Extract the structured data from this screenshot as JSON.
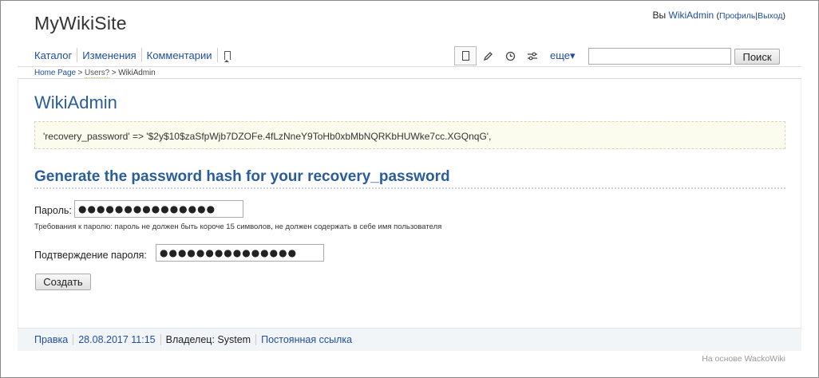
{
  "site": {
    "title": "MyWikiSite"
  },
  "user": {
    "prefix": "Вы",
    "name": "WikiAdmin",
    "open_paren": "(",
    "profile": "Профиль",
    "pipe": "|",
    "logout": "Выход",
    "close_paren": ")"
  },
  "nav": {
    "items": [
      "Каталог",
      "Изменения",
      "Комментарии"
    ]
  },
  "toolbar": {
    "more_label": "еще▾",
    "icons": [
      "page-icon",
      "pencil-icon",
      "clock-icon",
      "sliders-icon"
    ]
  },
  "search": {
    "value": "",
    "placeholder": "",
    "button_label": "Поиск"
  },
  "breadcrumb": {
    "home": "Home Page",
    "sep1": " > ",
    "users": "Users?",
    "sep2": " > ",
    "current": "WikiAdmin"
  },
  "page": {
    "title": "WikiAdmin",
    "code": "'recovery_password' => '$2y$10$zaSfpWjb7DZOFe.4fLzNneY9ToHb0xbMbNQRKbHUWke7cc.XGQnqG',"
  },
  "form": {
    "section_title": "Generate the password hash for your recovery_password",
    "password_label": "Пароль:",
    "password_value": "●●●●●●●●●●●●●●●",
    "hint": "Требования к паролю: пароль не должен быть короче 15 символов, не должен содержать в себе имя пользователя",
    "confirm_label": "Подтверждение пароля:",
    "confirm_value": "●●●●●●●●●●●●●●●",
    "submit_label": "Создать"
  },
  "footer": {
    "edit": "Правка",
    "date": "28.08.2017 11:15",
    "owner": "Владелец: System",
    "permalink": "Постоянная ссылка",
    "powered": "На основе WackoWiki"
  },
  "colors": {
    "link": "#1f4e9c",
    "title": "#2a5d9a",
    "code_bg": "#fcfcee",
    "footer_bg": "#f2f5f8"
  }
}
